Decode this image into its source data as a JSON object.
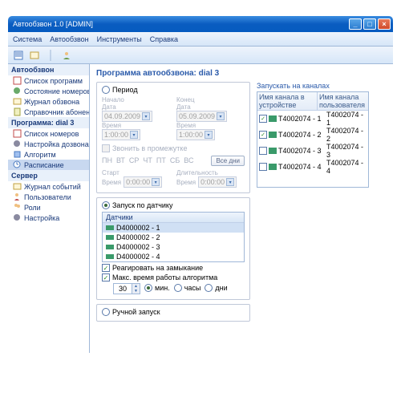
{
  "window": {
    "title": "Автообзвон 1.0 [ADMIN]"
  },
  "menu": {
    "system": "Система",
    "autodial": "Автообзвон",
    "tools": "Инструменты",
    "help": "Справка"
  },
  "sidebar": {
    "groups": [
      {
        "title": "Автообзвон",
        "items": [
          {
            "label": "Список программ",
            "icon": "list"
          },
          {
            "label": "Состояние номеров",
            "icon": "state"
          },
          {
            "label": "Журнал обзвона",
            "icon": "log"
          },
          {
            "label": "Справочник абонентов",
            "icon": "book"
          }
        ]
      },
      {
        "title": "Программа: dial 3",
        "items": [
          {
            "label": "Список номеров",
            "icon": "list"
          },
          {
            "label": "Настройка дозвона",
            "icon": "gear"
          },
          {
            "label": "Алгоритм",
            "icon": "algo"
          },
          {
            "label": "Расписание",
            "icon": "sched",
            "selected": true
          }
        ]
      },
      {
        "title": "Сервер",
        "items": [
          {
            "label": "Журнал событий",
            "icon": "log"
          },
          {
            "label": "Пользователи",
            "icon": "users"
          },
          {
            "label": "Роли",
            "icon": "roles"
          },
          {
            "label": "Настройка",
            "icon": "gear"
          }
        ]
      }
    ]
  },
  "main": {
    "title": "Программа автообзвона: dial 3",
    "period": {
      "label": "Период",
      "start": "Начало",
      "end": "Конец",
      "date": "Дата",
      "time": "Время",
      "date1": "04.09.2009",
      "date2": "05.09.2009",
      "time1": "1:00:00",
      "time2": "1:00:00",
      "gaps": "Звонить в промежутке",
      "days": [
        "ПН",
        "ВТ",
        "СР",
        "ЧТ",
        "ПТ",
        "СБ",
        "ВС"
      ],
      "alldays": "Все дни",
      "startl": "Старт",
      "durl": "Длительность",
      "startv": "0:00:00",
      "durv": "0:00:00"
    },
    "sensor": {
      "label": "Запуск по датчику",
      "col": "Датчики",
      "items": [
        "D4000002 - 1",
        "D4000002 - 2",
        "D4000002 - 3",
        "D4000002 - 4"
      ],
      "react": "Реагировать на замыкание",
      "maxtime": "Макс. время работы алгоритма",
      "maxval": "30",
      "units": {
        "min": "мин.",
        "hour": "часы",
        "day": "дни"
      }
    },
    "manual": "Ручной запуск",
    "channels": {
      "title": "Запускать на каналах",
      "col1": "Имя канала в устройстве",
      "col2": "Имя канала пользователя",
      "rows": [
        {
          "chk": true,
          "c1": "T4002074 - 1",
          "c2": "T4002074 - 1"
        },
        {
          "chk": true,
          "c1": "T4002074 - 2",
          "c2": "T4002074 - 2"
        },
        {
          "chk": false,
          "c1": "T4002074 - 3",
          "c2": "T4002074 - 3"
        },
        {
          "chk": false,
          "c1": "T4002074 - 4",
          "c2": "T4002074 - 4"
        }
      ]
    }
  }
}
